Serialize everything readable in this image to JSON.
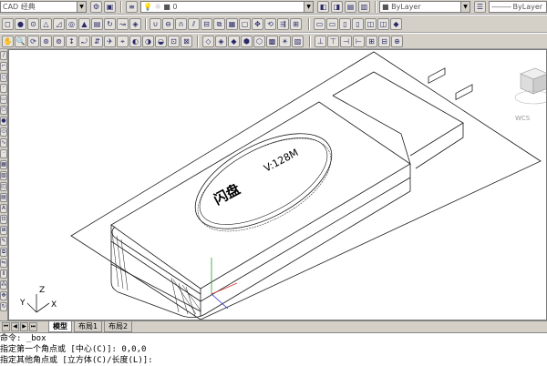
{
  "toolbar_top": {
    "workspace": "CAD 经典",
    "layer_value": "0",
    "color_value": "ByLayer",
    "linetype_value": "ByLayer",
    "lineweight_value": "ByLayer"
  },
  "drawing": {
    "body_label_cn": "闪盘",
    "body_label_en": "V:128M",
    "ucs_x": "X",
    "ucs_y": "Y",
    "ucs_z": "Z"
  },
  "tabs": {
    "model": "模型",
    "layout1": "布局1",
    "layout2": "布局2"
  },
  "command": {
    "line1": "命令: _box",
    "line2": "指定第一个角点或 [中心(C)]: 0,0,0",
    "line3": "指定其他角点或 [立方体(C)/长度(L)]:"
  },
  "icons": [
    "save-icon",
    "open-icon",
    "layer-icon",
    "properties-icon",
    "zoom-icon",
    "orbit-icon",
    "viewcube-icon"
  ],
  "colors": {
    "canvas_bg": "#ffffff",
    "ui_gray": "#d4d0c8",
    "line": "#1a1a1a"
  }
}
